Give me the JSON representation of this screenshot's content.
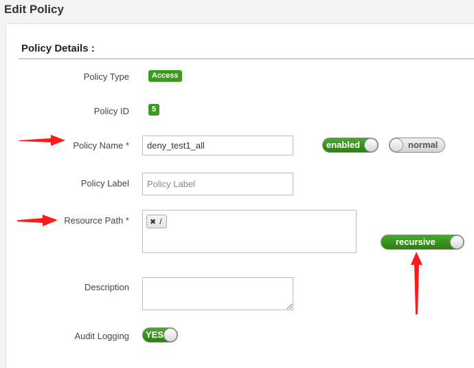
{
  "page": {
    "title": "Edit Policy"
  },
  "section": {
    "title": "Policy Details :"
  },
  "fields": {
    "policy_type": {
      "label": "Policy Type",
      "value": "Access"
    },
    "policy_id": {
      "label": "Policy ID",
      "value": "5"
    },
    "policy_name": {
      "label": "Policy Name *",
      "value": "deny_test1_all"
    },
    "policy_label": {
      "label": "Policy Label",
      "placeholder": "Policy Label"
    },
    "resource_path": {
      "label": "Resource Path *",
      "tags": [
        "/"
      ]
    },
    "description": {
      "label": "Description",
      "value": ""
    },
    "audit_logging": {
      "label": "Audit Logging"
    }
  },
  "toggles": {
    "enabled": {
      "label": "enabled",
      "state": "on"
    },
    "normal": {
      "label": "normal",
      "state": "off"
    },
    "recursive": {
      "label": "recursive",
      "state": "on"
    },
    "audit": {
      "label": "YES",
      "state": "on"
    }
  },
  "colors": {
    "accent_green": "#3a9b1e",
    "annotation_red": "#ff1a1a",
    "section_rule": "#8cbf5c"
  }
}
